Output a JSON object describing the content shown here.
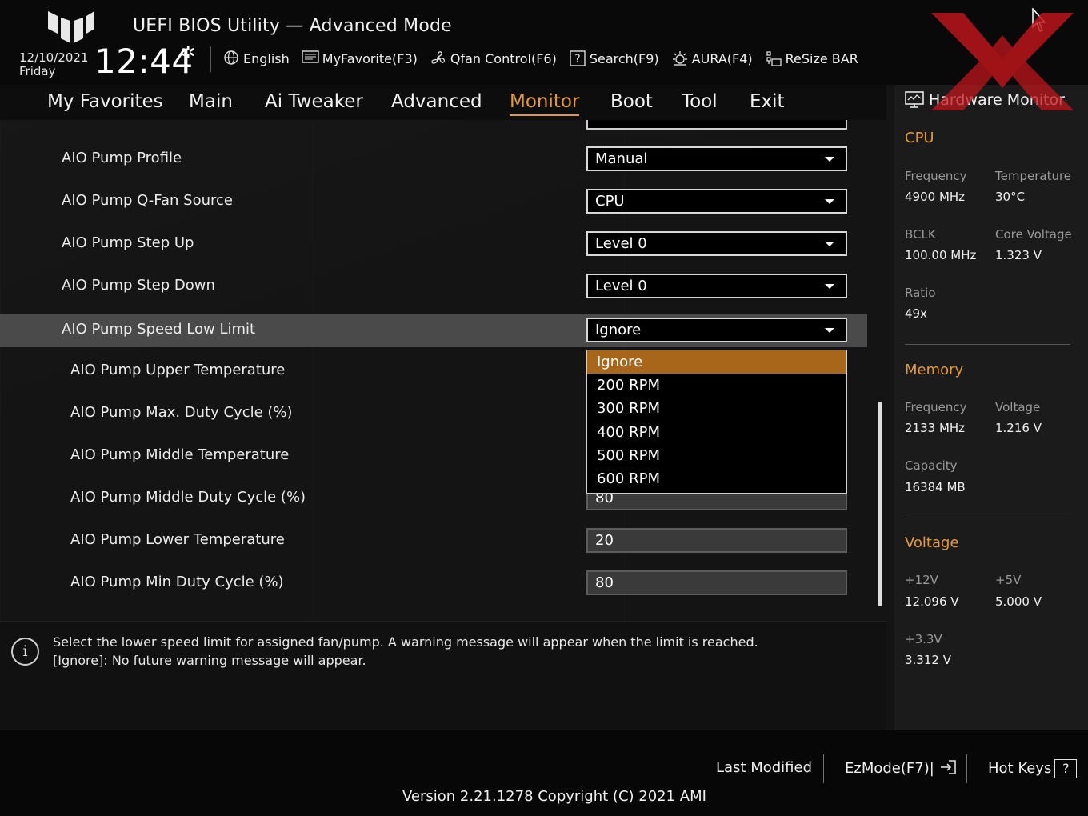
{
  "header": {
    "title": "UEFI BIOS Utility — Advanced Mode",
    "date": "12/10/2021",
    "day": "Friday",
    "time": "12:44",
    "toolbar": [
      {
        "icon": "globe-icon",
        "label": "English"
      },
      {
        "icon": "favorite-icon",
        "label": "MyFavorite(F3)"
      },
      {
        "icon": "fan-icon",
        "label": "Qfan Control(F6)"
      },
      {
        "icon": "search-icon",
        "label": "Search(F9)"
      },
      {
        "icon": "aura-icon",
        "label": "AURA(F4)"
      },
      {
        "icon": "resize-bar-icon",
        "label": "ReSize BAR"
      }
    ]
  },
  "tabs": [
    "My Favorites",
    "Main",
    "Ai Tweaker",
    "Advanced",
    "Monitor",
    "Boot",
    "Tool",
    "Exit"
  ],
  "active_tab": "Monitor",
  "settings": [
    {
      "label": "AIO Pump Profile",
      "value": "Manual",
      "type": "select"
    },
    {
      "label": "AIO Pump Q-Fan Source",
      "value": "CPU",
      "type": "select"
    },
    {
      "label": "AIO Pump Step Up",
      "value": "Level 0",
      "type": "select"
    },
    {
      "label": "AIO Pump Step Down",
      "value": "Level 0",
      "type": "select"
    },
    {
      "label": "AIO Pump Speed Low Limit",
      "value": "Ignore",
      "type": "select",
      "highlighted": true
    },
    {
      "label": "AIO Pump Upper Temperature",
      "value": "",
      "type": "text"
    },
    {
      "label": "AIO Pump Max. Duty Cycle (%)",
      "value": "",
      "type": "text"
    },
    {
      "label": "AIO Pump Middle Temperature",
      "value": "",
      "type": "text"
    },
    {
      "label": "AIO Pump Middle Duty Cycle (%)",
      "value": "80",
      "type": "text"
    },
    {
      "label": "AIO Pump Lower Temperature",
      "value": "20",
      "type": "text"
    },
    {
      "label": "AIO Pump Min Duty Cycle (%)",
      "value": "80",
      "type": "text"
    }
  ],
  "dropdown": {
    "options": [
      "Ignore",
      "200 RPM",
      "300 RPM",
      "400 RPM",
      "500 RPM",
      "600 RPM"
    ],
    "selected": "Ignore"
  },
  "info": {
    "line1": "Select the lower speed limit for assigned fan/pump. A warning message will appear when the limit is reached.",
    "line2": "[Ignore]: No future warning message will appear."
  },
  "hardware_monitor": {
    "title": "Hardware Monitor",
    "cpu": {
      "heading": "CPU",
      "frequency_label": "Frequency",
      "frequency": "4900 MHz",
      "temperature_label": "Temperature",
      "temperature": "30°C",
      "bclk_label": "BCLK",
      "bclk": "100.00 MHz",
      "core_voltage_label": "Core Voltage",
      "core_voltage": "1.323 V",
      "ratio_label": "Ratio",
      "ratio": "49x"
    },
    "memory": {
      "heading": "Memory",
      "frequency_label": "Frequency",
      "frequency": "2133 MHz",
      "voltage_label": "Voltage",
      "voltage": "1.216 V",
      "capacity_label": "Capacity",
      "capacity": "16384 MB"
    },
    "voltage": {
      "heading": "Voltage",
      "v12_label": "+12V",
      "v12": "12.096 V",
      "v5_label": "+5V",
      "v5": "5.000 V",
      "v33_label": "+3.3V",
      "v33": "3.312 V"
    }
  },
  "footer": {
    "last_modified": "Last Modified",
    "ezmode": "EzMode(F7)|",
    "hot_keys": "Hot Keys",
    "hot_keys_icon": "?",
    "version": "Version 2.21.1278 Copyright (C) 2021 AMI"
  },
  "colors": {
    "accent": "#e39a34",
    "dropdown_selected": "#a8661b",
    "watermark": "#c0161c"
  }
}
